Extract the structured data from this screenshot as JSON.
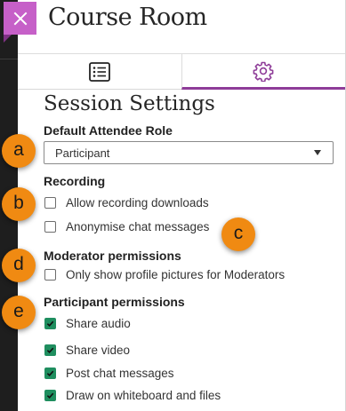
{
  "header": {
    "title": "Course Room",
    "close_icon": "close-icon"
  },
  "tabs": [
    {
      "name": "tab-content",
      "icon": "list-icon",
      "active": false
    },
    {
      "name": "tab-settings",
      "icon": "gear-icon",
      "active": true
    }
  ],
  "settings": {
    "title": "Session Settings",
    "default_role": {
      "label": "Default Attendee Role",
      "value": "Participant"
    },
    "recording": {
      "label": "Recording",
      "options": [
        {
          "label": "Allow recording downloads",
          "checked": false
        },
        {
          "label": "Anonymise chat messages",
          "checked": false
        }
      ]
    },
    "moderator": {
      "label": "Moderator permissions",
      "options": [
        {
          "label": "Only show profile pictures for Moderators",
          "checked": false
        }
      ]
    },
    "participant": {
      "label": "Participant permissions",
      "options": [
        {
          "label": "Share audio",
          "checked": true
        },
        {
          "label": "Share video",
          "checked": true
        },
        {
          "label": "Post chat messages",
          "checked": true
        },
        {
          "label": "Draw on whiteboard and files",
          "checked": true
        }
      ]
    }
  },
  "callouts": [
    "a",
    "b",
    "c",
    "d",
    "e"
  ],
  "colors": {
    "accent": "#8e3c98",
    "close_button": "#c660c8",
    "checkbox_checked": "#1f8e5f",
    "callout": "#f08a12"
  }
}
